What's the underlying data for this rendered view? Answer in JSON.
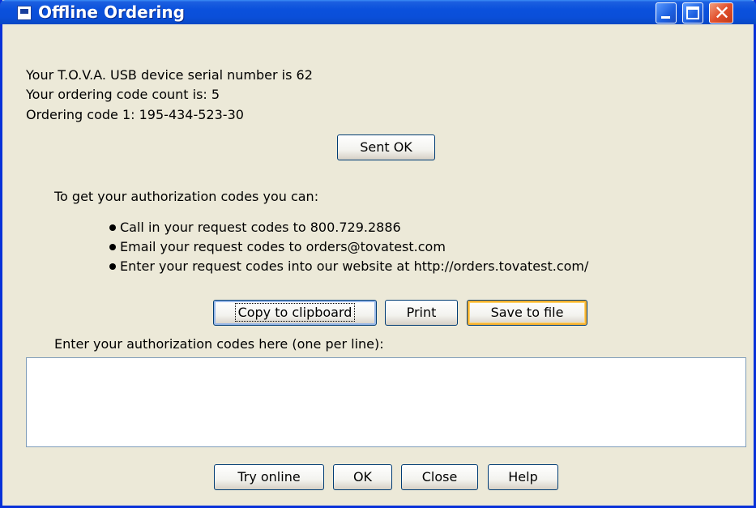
{
  "window": {
    "title": "Offline Ordering"
  },
  "info": {
    "serial_line": "Your T.O.V.A. USB device serial number is 62",
    "count_line": "Your ordering code count is: 5",
    "code_line": "Ordering code 1: 195-434-523-30"
  },
  "sent_ok_label": "Sent OK",
  "instructions": {
    "heading": "To get your authorization codes you can:",
    "bullets": [
      "Call in your request codes to 800.729.2886",
      "Email your request codes to orders@tovatest.com",
      "Enter your request codes into our website at http://orders.tovatest.com/"
    ]
  },
  "actions": {
    "copy_label": "Copy to clipboard",
    "print_label": "Print",
    "save_label": "Save to file"
  },
  "auth": {
    "label": "Enter your authorization codes here (one per line):",
    "value": ""
  },
  "footer": {
    "try_online_label": "Try online",
    "ok_label": "OK",
    "close_label": "Close",
    "help_label": "Help"
  },
  "colors": {
    "titlebar": "#0a50dc",
    "window_bg": "#ece9d8",
    "close_button": "#e2502c"
  }
}
